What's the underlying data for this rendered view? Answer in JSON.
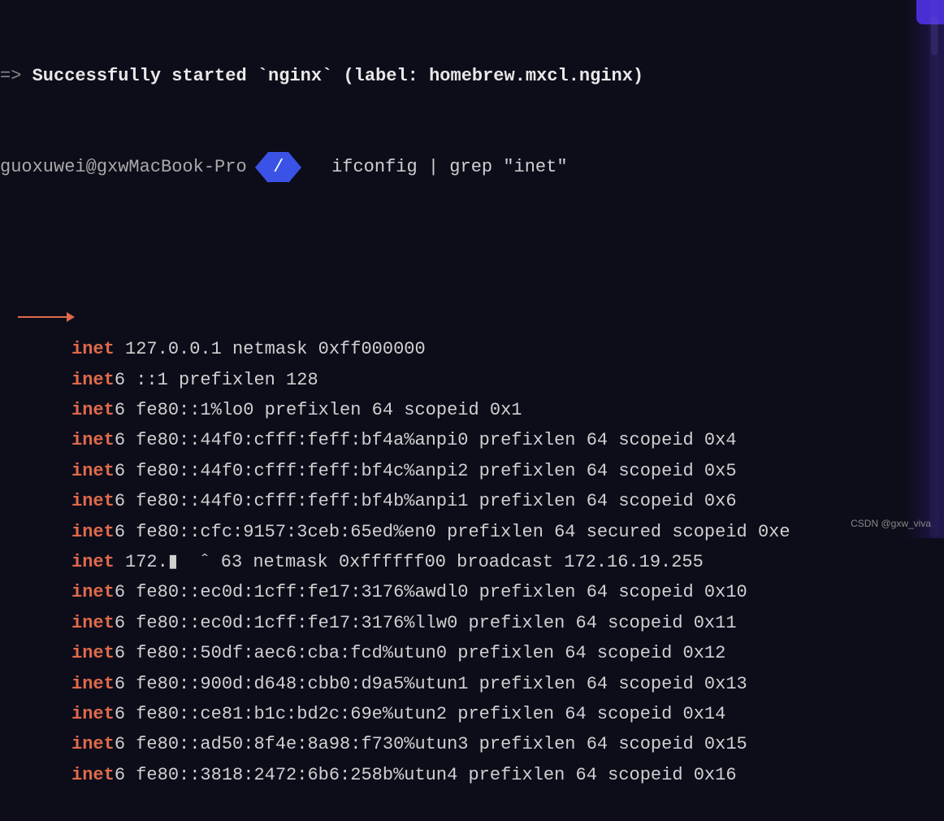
{
  "header": {
    "prefix": "=>",
    "status_line": "Successfully started `nginx` (label: homebrew.mxcl.nginx)"
  },
  "prompt": {
    "user_host": "guoxuwei@gxwMacBook-Pro",
    "segment": "/",
    "command": "ifconfig | grep \"inet\""
  },
  "output": [
    {
      "kw": "inet",
      "rest": " 127.0.0.1 netmask 0xff000000"
    },
    {
      "kw": "inet6",
      "rest": " ::1 prefixlen 128"
    },
    {
      "kw": "inet6",
      "rest": " fe80::1%lo0 prefixlen 64 scopeid 0x1"
    },
    {
      "kw": "inet6",
      "rest": " fe80::44f0:cfff:feff:bf4a%anpi0 prefixlen 64 scopeid 0x4"
    },
    {
      "kw": "inet6",
      "rest": " fe80::44f0:cfff:feff:bf4c%anpi2 prefixlen 64 scopeid 0x5"
    },
    {
      "kw": "inet6",
      "rest": " fe80::44f0:cfff:feff:bf4b%anpi1 prefixlen 64 scopeid 0x6"
    },
    {
      "kw": "inet6",
      "rest": " fe80::cfc:9157:3ceb:65ed%en0 prefixlen 64 secured scopeid 0xe"
    },
    {
      "kw": "inet",
      "rest": " 172.▮  ˆ 63 netmask 0xffffff00 broadcast 172.16.19.255",
      "redacted": true
    },
    {
      "kw": "inet6",
      "rest": " fe80::ec0d:1cff:fe17:3176%awdl0 prefixlen 64 scopeid 0x10"
    },
    {
      "kw": "inet6",
      "rest": " fe80::ec0d:1cff:fe17:3176%llw0 prefixlen 64 scopeid 0x11"
    },
    {
      "kw": "inet6",
      "rest": " fe80::50df:aec6:cba:fcd%utun0 prefixlen 64 scopeid 0x12"
    },
    {
      "kw": "inet6",
      "rest": " fe80::900d:d648:cbb0:d9a5%utun1 prefixlen 64 scopeid 0x13"
    },
    {
      "kw": "inet6",
      "rest": " fe80::ce81:b1c:bd2c:69e%utun2 prefixlen 64 scopeid 0x14"
    },
    {
      "kw": "inet6",
      "rest": " fe80::ad50:8f4e:8a98:f730%utun3 prefixlen 64 scopeid 0x15"
    },
    {
      "kw": "inet6",
      "rest": " fe80::3818:2472:6b6:258b%utun4 prefixlen 64 scopeid 0x16"
    }
  ],
  "annotation": {
    "arrow_color": "#e06a4a"
  },
  "watermark": "CSDN @gxw_viva"
}
